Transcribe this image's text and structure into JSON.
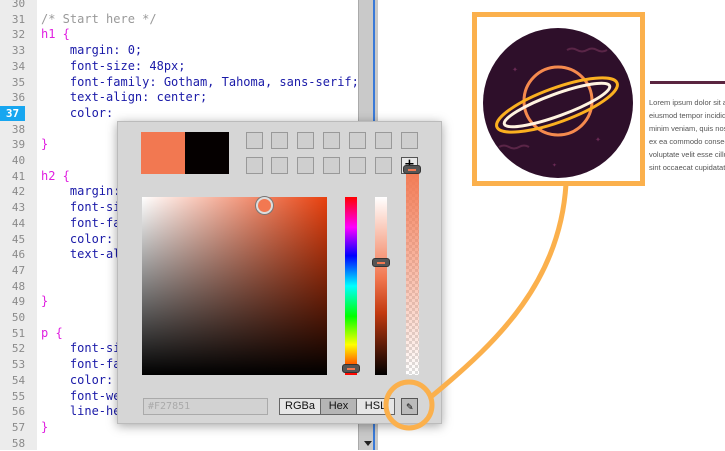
{
  "editor": {
    "line_numbers": [
      "30",
      "31",
      "32",
      "33",
      "34",
      "35",
      "36",
      "37",
      "38",
      "39",
      "40",
      "41",
      "42",
      "43",
      "44",
      "45",
      "46",
      "47",
      "48",
      "49",
      "50",
      "51",
      "52",
      "53",
      "54",
      "55",
      "56",
      "57",
      "58"
    ],
    "active_line": "37",
    "lines": [
      {
        "k": "",
        "t": ""
      },
      {
        "k": "",
        "c": "/* Start here */",
        "t": ""
      },
      {
        "k": "h1 {",
        "t": ""
      },
      {
        "k": "",
        "t": "    margin: 0;"
      },
      {
        "k": "",
        "t": "    font-size: 48px;"
      },
      {
        "k": "",
        "t": "    font-family: Gotham, Tahoma, sans-serif;"
      },
      {
        "k": "",
        "t": "    text-align: center;"
      },
      {
        "k": "",
        "t": "    color:"
      },
      {
        "k": "",
        "t": ""
      },
      {
        "k": "}",
        "t": ""
      },
      {
        "k": "",
        "t": ""
      },
      {
        "k": "h2 {",
        "t": ""
      },
      {
        "k": "",
        "t": "    margin:"
      },
      {
        "k": "",
        "t": "    font-si"
      },
      {
        "k": "",
        "t": "    font-fa"
      },
      {
        "k": "",
        "t": "    color:"
      },
      {
        "k": "",
        "t": "    text-al"
      },
      {
        "k": "",
        "t": ""
      },
      {
        "k": "",
        "t": ""
      },
      {
        "k": "}",
        "t": ""
      },
      {
        "k": "",
        "t": ""
      },
      {
        "k": "p {",
        "t": ""
      },
      {
        "k": "",
        "t": "    font-si"
      },
      {
        "k": "",
        "t": "    font-fa"
      },
      {
        "k": "",
        "t": "    color:"
      },
      {
        "k": "",
        "t": "    font-we"
      },
      {
        "k": "",
        "t": "    line-he"
      },
      {
        "k": "}",
        "t": ""
      },
      {
        "k": "",
        "t": ""
      }
    ]
  },
  "color_picker": {
    "current_color": "#F27851",
    "previous_color": "#000000",
    "hex_value": "#F27851",
    "modes": [
      "RGBa",
      "Hex",
      "HSL"
    ],
    "selected_mode": "Hex",
    "add_swatch_label": "+"
  },
  "preview": {
    "lorem_lines": [
      "Lorem ipsum dolor sit amet",
      "eiusmod tempor incididunt",
      "minim veniam, quis nostrud",
      "ex ea commodo consequat",
      "voluptate velit esse cillum",
      "sint occaecat cupidatat"
    ],
    "highlight_color": "#FBB04C"
  }
}
